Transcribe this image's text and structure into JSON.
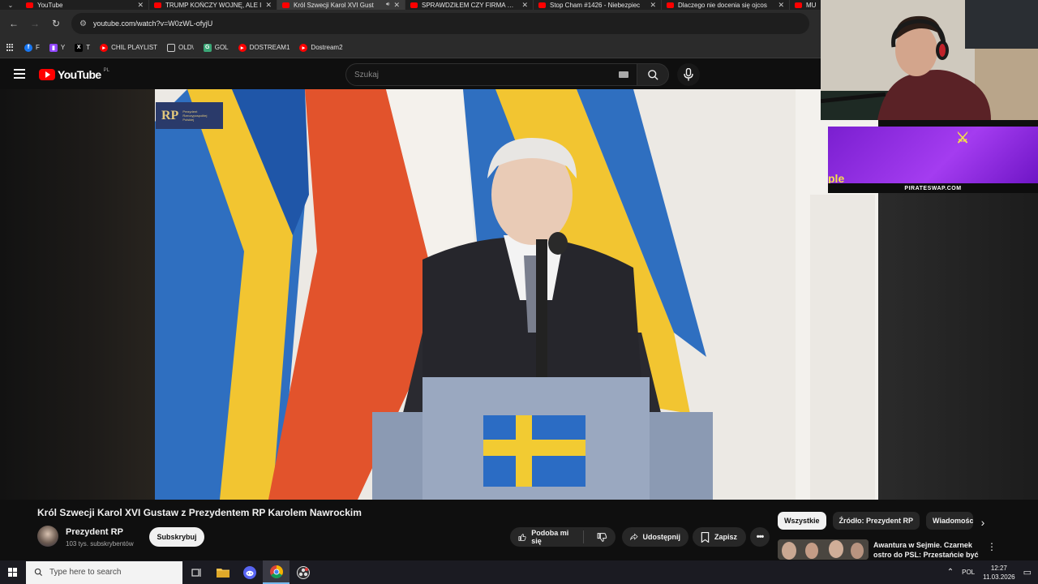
{
  "browser": {
    "tabs": [
      {
        "title": "YouTube",
        "active": false
      },
      {
        "title": "TRUMP KOŃCZY WOJNĘ, ALE I",
        "active": false
      },
      {
        "title": "Król Szwecji Karol XVI Gust",
        "active": true
      },
      {
        "title": "SPRAWDZIŁEM CZY FIRMA KAS",
        "active": false
      },
      {
        "title": "Stop Cham #1426 - Niebezpiec",
        "active": false
      },
      {
        "title": "Dlaczego nie docenia się ojcos",
        "active": false
      },
      {
        "title": "MU",
        "active": false
      }
    ],
    "url": "youtube.com/watch?v=W0zWL-ofyjU",
    "bookmarks": [
      {
        "label": "F",
        "icon": "facebook-icon",
        "color": "#1877f2"
      },
      {
        "label": "Y",
        "icon": "twitch-icon",
        "color": "#9146ff"
      },
      {
        "label": "T",
        "icon": "x-icon",
        "color": "#000000"
      },
      {
        "label": "CHIL PLAYLIST",
        "icon": "youtube-icon",
        "color": "#ff0000"
      },
      {
        "label": "OLD\\",
        "icon": "folder-icon",
        "color": "#cccccc"
      },
      {
        "label": "GOL",
        "icon": "g-icon",
        "color": "#3aa676"
      },
      {
        "label": "DOSTREAM1",
        "icon": "youtube-icon",
        "color": "#ff0000"
      },
      {
        "label": "Dostream2",
        "icon": "youtube-icon",
        "color": "#ff0000"
      }
    ]
  },
  "youtube": {
    "logo_text": "YouTube",
    "region": "PL",
    "search_placeholder": "Szukaj",
    "video": {
      "watermark": "RP",
      "watermark_sub": "Prezydent Rzeczypospolitej Polskiej",
      "title": "Król Szwecji Karol XVI Gustaw z Prezydentem RP Karolem Nawrockim",
      "channel": "Prezydent RP",
      "subscribers": "103 tys. subskrybentów",
      "subscribe_label": "Subskrybuj",
      "like_label": "Podoba mi się",
      "share_label": "Udostępnij",
      "save_label": "Zapisz"
    },
    "chips": [
      "Wszystkie",
      "Źródło: Prezydent RP",
      "Wiadomości"
    ],
    "recommendation": {
      "title": "Awantura w Sejmie. Czarnek ostro do PSL: Przestańcie być ..."
    }
  },
  "overlay": {
    "banner_text": "PIRATESWAP.COM",
    "banner_partial": "ple"
  },
  "taskbar": {
    "search_placeholder": "Type here to search",
    "language": "POL",
    "time": "12:27",
    "date": "11.03.2026"
  }
}
